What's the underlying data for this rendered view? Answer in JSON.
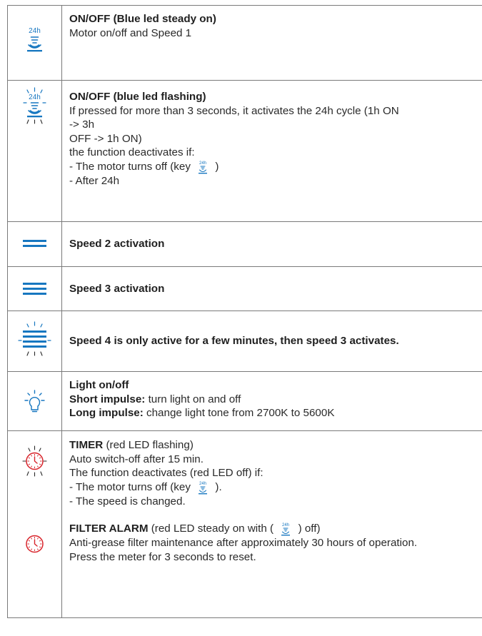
{
  "colors": {
    "accent": "#1777c0",
    "alarm": "#d8232a",
    "border": "#7a7a7a",
    "text": "#2a2a2a"
  },
  "icon_label_24h": "24h",
  "rows": [
    {
      "icon": "fan-24h-icon",
      "title": "ON/OFF (Blue led steady on)",
      "lines": [
        "Motor on/off and Speed 1"
      ]
    },
    {
      "icon": "fan-24h-flashing-icon",
      "title": "ON/OFF (blue led flashing)",
      "lines": [
        "If pressed for more than 3 seconds, it activates the 24h cycle (1h ON",
        "-> 3h",
        "OFF -> 1h ON)",
        "the function deactivates if:",
        "- The motor turns off (key",
        ")",
        "- After 24h"
      ]
    },
    {
      "icon": "speed-2-icon",
      "title": "Speed 2 activation"
    },
    {
      "icon": "speed-3-icon",
      "title": "Speed 3 activation"
    },
    {
      "icon": "speed-4-flashing-icon",
      "title": "Speed 4 is only active for a few minutes, then speed 3 activates."
    },
    {
      "icon": "light-bulb-icon",
      "title": "Light on/off",
      "short_label": "Short impulse:",
      "short_text": "turn light on and off",
      "long_label": "Long impulse:",
      "long_text": "change light tone from 2700K to 5600K"
    },
    {
      "icon": "timer-clock-icon",
      "timer_title": "TIMER",
      "timer_note": "(red LED flashing)",
      "timer_lines": [
        "Auto switch-off after 15 min.",
        "The function deactivates (red LED off) if:",
        "- The motor turns off (key",
        ").",
        "- The speed is changed."
      ],
      "alarm_icon": "filter-alarm-clock-icon",
      "alarm_title": "FILTER ALARM",
      "alarm_note": "(red LED steady on with (",
      "alarm_note_end": ") off)",
      "alarm_lines": [
        "Anti-grease filter maintenance after approximately 30 hours of operation.",
        "Press the meter for 3 seconds to reset."
      ]
    }
  ]
}
